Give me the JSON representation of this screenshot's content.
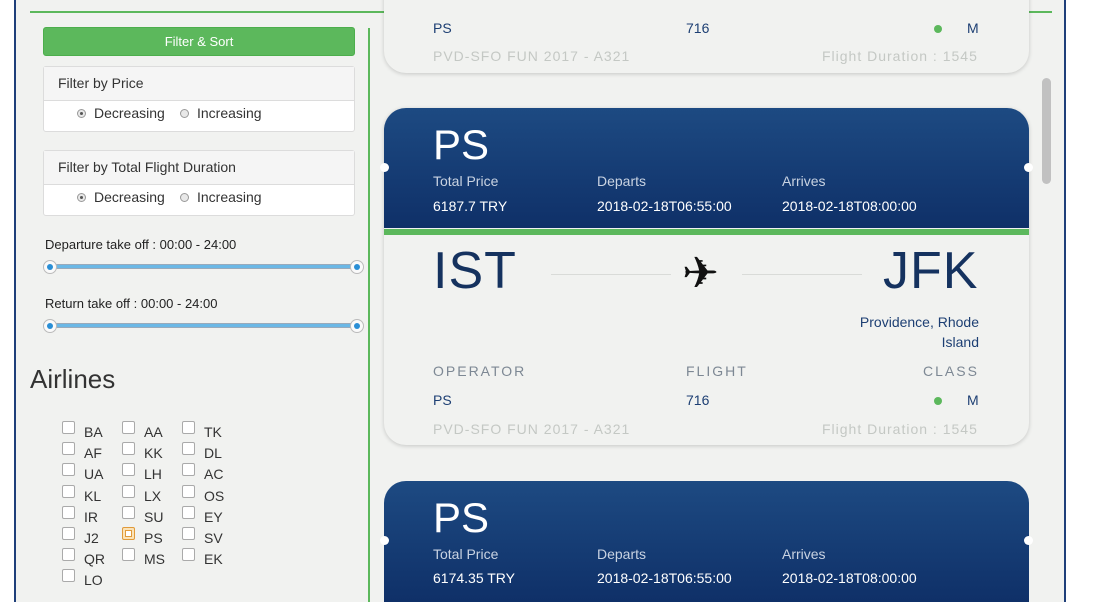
{
  "sidebar": {
    "filter_button": "Filter & Sort",
    "price_filter": {
      "title": "Filter by Price",
      "options": [
        "Decreasing",
        "Increasing"
      ],
      "selected": "Decreasing"
    },
    "duration_filter": {
      "title": "Filter by Total Flight Duration",
      "options": [
        "Decreasing",
        "Increasing"
      ],
      "selected": "Decreasing"
    },
    "departure_range": {
      "label": "Departure take off : 00:00 - 24:00",
      "min": 0,
      "max": 24
    },
    "return_range": {
      "label": "Return take off : 00:00 - 24:00",
      "min": 0,
      "max": 24
    },
    "airlines_title": "Airlines",
    "airlines": [
      [
        "BA",
        "AA",
        "TK"
      ],
      [
        "AF",
        "KK",
        "DL"
      ],
      [
        "UA",
        "LH",
        "AC"
      ],
      [
        "KL",
        "LX",
        "OS"
      ],
      [
        "IR",
        "SU",
        "EY"
      ],
      [
        "J2",
        "PS",
        "SV"
      ],
      [
        "QR",
        "MS",
        "EK"
      ],
      [
        "LO"
      ]
    ],
    "checked_airline": "PS"
  },
  "results": {
    "partial_card": {
      "operator": "PS",
      "flight": "716",
      "class": "M",
      "footer_left": "PVD-SFO FUN 2017 - A321",
      "footer_right": "Flight Duration : 1545"
    },
    "cards": [
      {
        "airline": "PS",
        "price_label": "Total Price",
        "price": "6187.7 TRY",
        "departs_label": "Departs",
        "departs": "2018-02-18T06:55:00",
        "arrives_label": "Arrives",
        "arrives": "2018-02-18T08:00:00",
        "from": "IST",
        "to": "JFK",
        "city_line1": "Providence, Rhode",
        "city_line2": "Island",
        "operator_label": "OPERATOR",
        "flight_label": "FLIGHT",
        "class_label": "CLASS",
        "operator": "PS",
        "flight": "716",
        "class": "M",
        "footer_left": "PVD-SFO FUN 2017 - A321",
        "footer_right": "Flight Duration : 1545"
      },
      {
        "airline": "PS",
        "price_label": "Total Price",
        "price": "6174.35 TRY",
        "departs_label": "Departs",
        "departs": "2018-02-18T06:55:00",
        "arrives_label": "Arrives",
        "arrives": "2018-02-18T08:00:00"
      }
    ],
    "plane_glyph": "✈"
  },
  "colors": {
    "accent_green": "#5cb85c",
    "card_navy": "#0f3068",
    "frame_blue": "#1f3f7a"
  }
}
